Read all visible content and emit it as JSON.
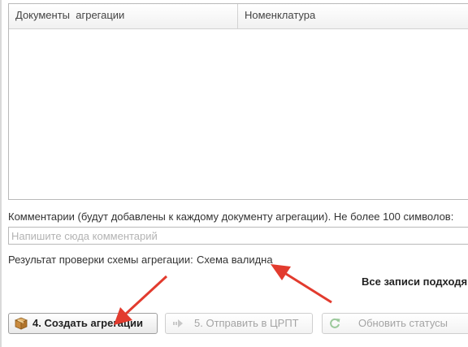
{
  "grid": {
    "columns": [
      "Документы  агрегации",
      "Номенклатура"
    ]
  },
  "comment": {
    "label": "Комментарии (будут добавлены к каждому документу агрегации). Не более 100 символов:",
    "placeholder": "Напишите сюда комментарий",
    "value": ""
  },
  "validation": {
    "label": "Результат проверки схемы агрегации:",
    "value": "Схема валидна"
  },
  "records_text": "Все записи подходя",
  "buttons": {
    "create": {
      "label": "4. Создать агрегации",
      "icon": "package-icon",
      "enabled": true
    },
    "send": {
      "label": "5. Отправить в ЦРПТ",
      "icon": "send-arrow-icon",
      "enabled": false
    },
    "refresh": {
      "label": "Обновить статусы",
      "icon": "refresh-icon",
      "enabled": false
    }
  },
  "colors": {
    "annotation_arrow": "#e23b2e",
    "border": "#b9b9b9",
    "disabled_text": "#a4a4a4"
  }
}
